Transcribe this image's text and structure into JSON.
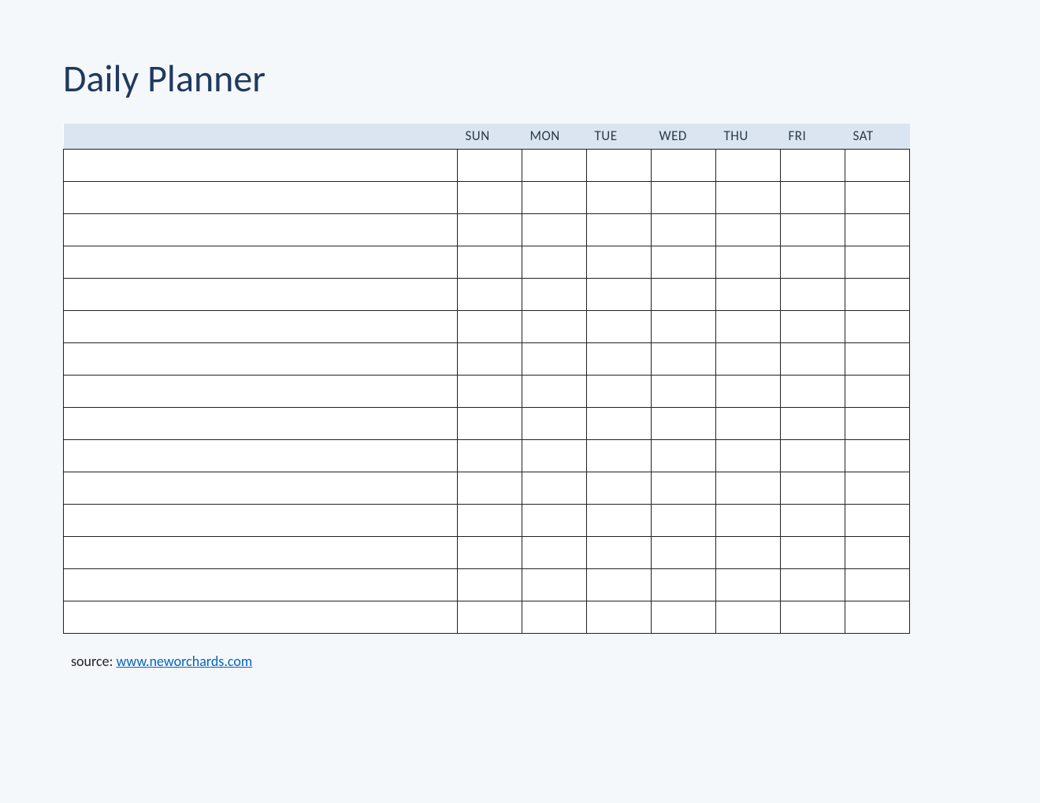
{
  "title": "Daily Planner",
  "days": [
    "SUN",
    "MON",
    "TUE",
    "WED",
    "THU",
    "FRI",
    "SAT"
  ],
  "rows": 15,
  "source": {
    "label": "source: ",
    "link_text": "www.neworchards.com"
  }
}
